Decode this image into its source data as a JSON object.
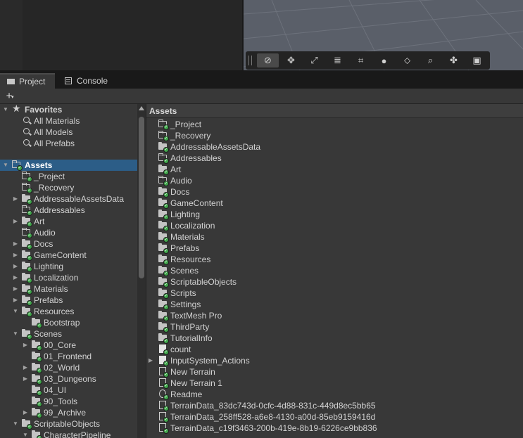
{
  "tabs": [
    {
      "label": "Project",
      "icon": "folder-icon",
      "active": true
    },
    {
      "label": "Console",
      "icon": "console-icon",
      "active": false
    }
  ],
  "toolbar": {
    "plus_label": "+",
    "scene_tools": [
      "compass-icon",
      "move-icon",
      "scale-icon",
      "align-icon",
      "grid-snap-icon",
      "sphere-icon",
      "layers-icon",
      "search-icon",
      "pivot-icon",
      "camera-icon"
    ]
  },
  "tree": {
    "favorites": {
      "label": "Favorites",
      "items": [
        "All Materials",
        "All Models",
        "All Prefabs"
      ]
    },
    "assets_label": "Assets",
    "items": [
      {
        "label": "_Project",
        "level": 1,
        "arrow": "",
        "icon": "empty"
      },
      {
        "label": "_Recovery",
        "level": 1,
        "arrow": "",
        "icon": "empty"
      },
      {
        "label": "AddressableAssetsData",
        "level": 1,
        "arrow": "right",
        "icon": "folder"
      },
      {
        "label": "Addressables",
        "level": 1,
        "arrow": "",
        "icon": "empty"
      },
      {
        "label": "Art",
        "level": 1,
        "arrow": "right",
        "icon": "folder"
      },
      {
        "label": "Audio",
        "level": 1,
        "arrow": "",
        "icon": "empty"
      },
      {
        "label": "Docs",
        "level": 1,
        "arrow": "right",
        "icon": "folder"
      },
      {
        "label": "GameContent",
        "level": 1,
        "arrow": "right",
        "icon": "folder"
      },
      {
        "label": "Lighting",
        "level": 1,
        "arrow": "right",
        "icon": "folder"
      },
      {
        "label": "Localization",
        "level": 1,
        "arrow": "right",
        "icon": "folder"
      },
      {
        "label": "Materials",
        "level": 1,
        "arrow": "right",
        "icon": "folder"
      },
      {
        "label": "Prefabs",
        "level": 1,
        "arrow": "right",
        "icon": "folder"
      },
      {
        "label": "Resources",
        "level": 1,
        "arrow": "down",
        "icon": "folder"
      },
      {
        "label": "Bootstrap",
        "level": 2,
        "arrow": "",
        "icon": "folder"
      },
      {
        "label": "Scenes",
        "level": 1,
        "arrow": "down",
        "icon": "folder"
      },
      {
        "label": "00_Core",
        "level": 2,
        "arrow": "right",
        "icon": "folder"
      },
      {
        "label": "01_Frontend",
        "level": 2,
        "arrow": "",
        "icon": "folder"
      },
      {
        "label": "02_World",
        "level": 2,
        "arrow": "right",
        "icon": "folder"
      },
      {
        "label": "03_Dungeons",
        "level": 2,
        "arrow": "right",
        "icon": "folder"
      },
      {
        "label": "04_UI",
        "level": 2,
        "arrow": "",
        "icon": "folder"
      },
      {
        "label": "90_Tools",
        "level": 2,
        "arrow": "",
        "icon": "folder"
      },
      {
        "label": "99_Archive",
        "level": 2,
        "arrow": "right",
        "icon": "folder"
      },
      {
        "label": "ScriptableObjects",
        "level": 1,
        "arrow": "down",
        "icon": "folder"
      },
      {
        "label": "CharacterPipeline",
        "level": 2,
        "arrow": "down",
        "icon": "folder"
      }
    ]
  },
  "main": {
    "header": "Assets",
    "items": [
      {
        "label": "_Project",
        "icon": "empty",
        "arrow": false
      },
      {
        "label": "_Recovery",
        "icon": "empty",
        "arrow": false
      },
      {
        "label": "AddressableAssetsData",
        "icon": "folder",
        "arrow": false
      },
      {
        "label": "Addressables",
        "icon": "empty",
        "arrow": false
      },
      {
        "label": "Art",
        "icon": "folder",
        "arrow": false
      },
      {
        "label": "Audio",
        "icon": "empty",
        "arrow": false
      },
      {
        "label": "Docs",
        "icon": "folder",
        "arrow": false
      },
      {
        "label": "GameContent",
        "icon": "folder",
        "arrow": false
      },
      {
        "label": "Lighting",
        "icon": "folder",
        "arrow": false
      },
      {
        "label": "Localization",
        "icon": "folder",
        "arrow": false
      },
      {
        "label": "Materials",
        "icon": "folder",
        "arrow": false
      },
      {
        "label": "Prefabs",
        "icon": "folder",
        "arrow": false
      },
      {
        "label": "Resources",
        "icon": "folder",
        "arrow": false
      },
      {
        "label": "Scenes",
        "icon": "folder",
        "arrow": false
      },
      {
        "label": "ScriptableObjects",
        "icon": "folder",
        "arrow": false
      },
      {
        "label": "Scripts",
        "icon": "folder",
        "arrow": false
      },
      {
        "label": "Settings",
        "icon": "folder",
        "arrow": false
      },
      {
        "label": "TextMesh Pro",
        "icon": "folder",
        "arrow": false
      },
      {
        "label": "ThirdParty",
        "icon": "folder",
        "arrow": false
      },
      {
        "label": "TutorialInfo",
        "icon": "folder",
        "arrow": false
      },
      {
        "label": "count",
        "icon": "doc",
        "arrow": false
      },
      {
        "label": "InputSystem_Actions",
        "icon": "doc",
        "arrow": true
      },
      {
        "label": "New Terrain",
        "icon": "terrain",
        "arrow": false
      },
      {
        "label": "New Terrain 1",
        "icon": "terrain",
        "arrow": false
      },
      {
        "label": "Readme",
        "icon": "readme",
        "arrow": false
      },
      {
        "label": "TerrainData_83dc743d-0cfc-4d88-831c-449d8ec5bb65",
        "icon": "terrain",
        "arrow": false
      },
      {
        "label": "TerrainData_258ff528-a6e8-4130-a00d-85eb9159416d",
        "icon": "terrain",
        "arrow": false
      },
      {
        "label": "TerrainData_c19f3463-200b-419e-8b19-6226ce9bb836",
        "icon": "terrain",
        "arrow": false
      }
    ]
  },
  "colors": {
    "selection": "#2c5d87",
    "panel": "#383838",
    "badge": "#3fa64a"
  }
}
